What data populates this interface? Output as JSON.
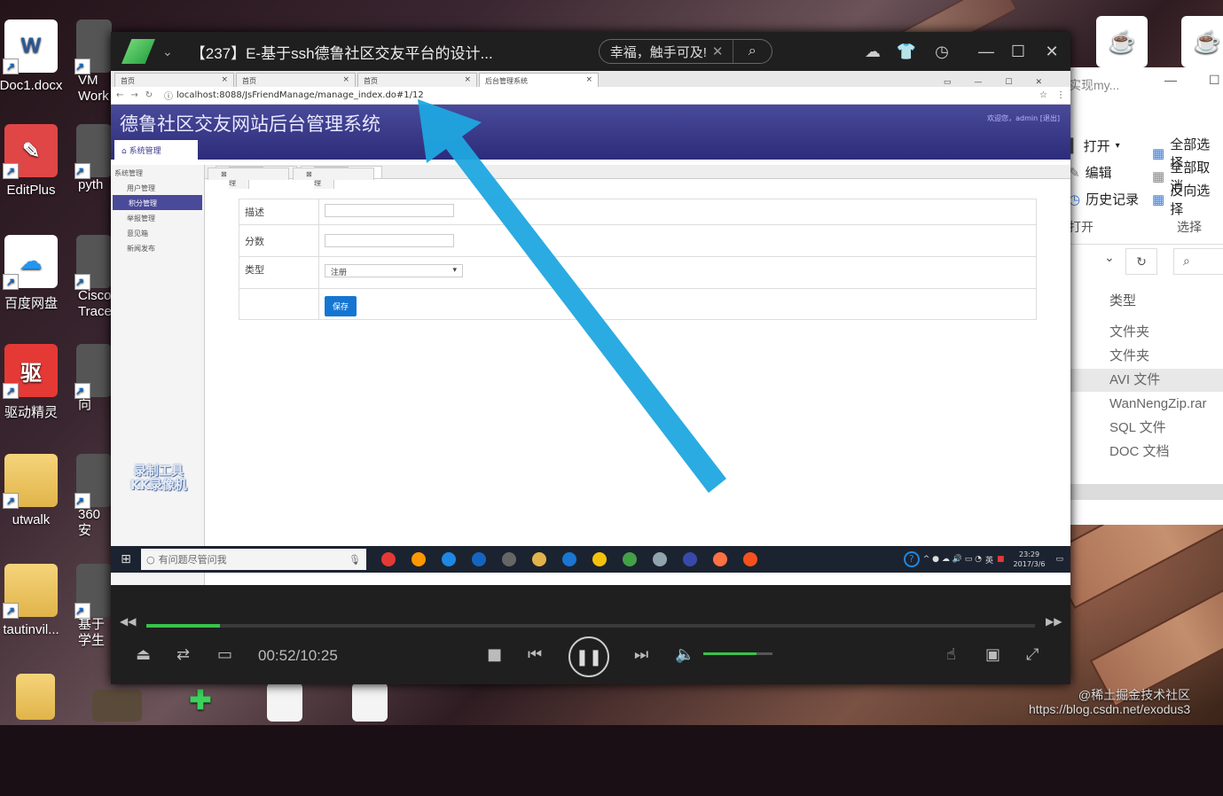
{
  "desktop": {
    "icons": [
      {
        "label": "Doc1.docx",
        "glyph": "W",
        "bg": "#ffffff",
        "fg": "#2b5797"
      },
      {
        "label": "EditPlus",
        "glyph": "✎",
        "bg": "#e04646",
        "fg": "#ffffff"
      },
      {
        "label": "百度网盘",
        "glyph": "☁",
        "bg": "#ffffff",
        "fg": "#2196f3"
      },
      {
        "label": "驱动精灵",
        "glyph": "驱",
        "bg": "#e53935",
        "fg": "#ffffff"
      },
      {
        "label": "utwalk",
        "glyph": "",
        "bg": "folder",
        "fg": "#fff"
      },
      {
        "label": "tautinvil...",
        "glyph": "",
        "bg": "folder",
        "fg": "#fff"
      }
    ],
    "partial_icons": [
      "VM\nWork",
      "pyth",
      "Cisco\nTrace",
      "向",
      "360安",
      "基于\n学生"
    ]
  },
  "explorer": {
    "title": "实现my...",
    "ribbon": {
      "open": "打开",
      "edit": "编辑",
      "history": "历史记录",
      "open_group": "打开",
      "select_all": "全部选择",
      "select_none": "全部取消",
      "invert": "反向选择",
      "select_group": "选择"
    },
    "type_header": "类型",
    "types": [
      "文件夹",
      "文件夹",
      "AVI 文件",
      "WanNengZip.rar",
      "SQL 文件",
      "DOC 文档"
    ]
  },
  "player": {
    "title": "【237】E-基于ssh德鲁社区交友平台的设计...",
    "search_value": "幸福，触手可及!",
    "current_time": "00:52/10:25",
    "progress": 0.083,
    "volume": 0.77
  },
  "browser": {
    "tabs": [
      "首页",
      "首页",
      "首页",
      "后台管理系统"
    ],
    "url": "localhost:8088/JsFriendManage/manage_index.do#1/12"
  },
  "app": {
    "title": "德鲁社区交友网站后台管理系统",
    "welcome": "欢迎您，admin [退出]",
    "menu_tab": "系统管理",
    "sidebar": [
      "系统管理",
      "用户管理",
      "积分管理",
      "举报管理",
      "意见箱",
      "新闻发布"
    ],
    "subtabs": [
      "用户管理",
      "积分管理"
    ],
    "form": {
      "desc_label": "描述",
      "score_label": "分数",
      "type_label": "类型",
      "type_value": "注册",
      "save": "保存"
    },
    "watermark": "录制工具\nKK录像机"
  },
  "taskbar": {
    "search": "有问题尽管问我",
    "time": "23:29",
    "date": "2017/3/6",
    "ime": "英"
  },
  "watermark": "@稀土掘金技术社区\nhttps://blog.csdn.net/exodus3"
}
